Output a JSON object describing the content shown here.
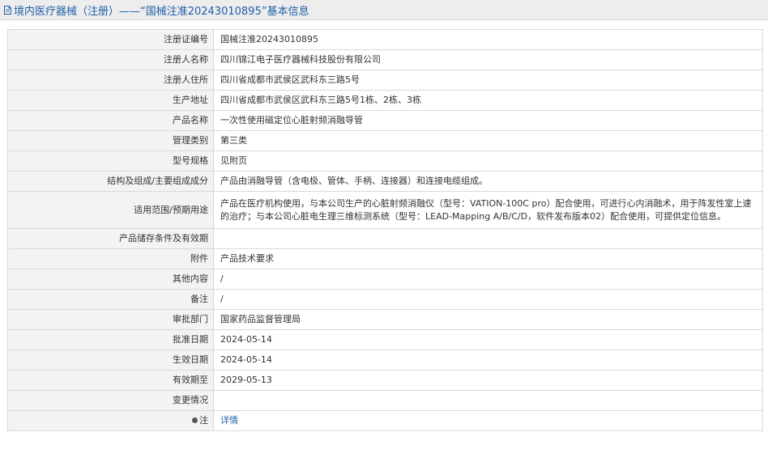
{
  "header": {
    "title": "境内医疗器械（注册）——“国械注准20243010895”基本信息",
    "icon": "document-icon"
  },
  "rows": [
    {
      "label": "注册证编号",
      "value": "国械注准20243010895"
    },
    {
      "label": "注册人名称",
      "value": "四川锦江电子医疗器械科技股份有限公司"
    },
    {
      "label": "注册人住所",
      "value": "四川省成都市武侯区武科东三路5号"
    },
    {
      "label": "生产地址",
      "value": "四川省成都市武侯区武科东三路5号1栋、2栋、3栋"
    },
    {
      "label": "产品名称",
      "value": "一次性使用磁定位心脏射频消融导管"
    },
    {
      "label": "管理类别",
      "value": "第三类"
    },
    {
      "label": "型号规格",
      "value": "见附页"
    },
    {
      "label": "结构及组成/主要组成成分",
      "value": "产品由消融导管（含电极、管体、手柄、连接器）和连接电缆组成。"
    },
    {
      "label": "适用范围/预期用途",
      "value": "产品在医疗机构使用，与本公司生产的心脏射频消融仪（型号：VATION-100C pro）配合使用，可进行心内消融术，用于阵发性室上速的治疗；与本公司心脏电生理三维标测系统（型号：LEAD-Mapping A/B/C/D，软件发布版本02）配合使用，可提供定位信息。"
    },
    {
      "label": "产品储存条件及有效期",
      "value": ""
    },
    {
      "label": "附件",
      "value": "产品技术要求"
    },
    {
      "label": "其他内容",
      "value": "/"
    },
    {
      "label": "备注",
      "value": "/"
    },
    {
      "label": "审批部门",
      "value": "国家药品监督管理局"
    },
    {
      "label": "批准日期",
      "value": "2024-05-14"
    },
    {
      "label": "生效日期",
      "value": "2024-05-14"
    },
    {
      "label": "有效期至",
      "value": "2029-05-13"
    },
    {
      "label": "变更情况",
      "value": ""
    },
    {
      "label": "注",
      "value": "详情",
      "icon": "pin-icon"
    }
  ],
  "colors": {
    "header_text": "#1e5fa8",
    "header_bg": "#ededed",
    "label_bg": "#f3f3f3",
    "border": "#d9d9d9",
    "link": "#1e5fa8"
  }
}
